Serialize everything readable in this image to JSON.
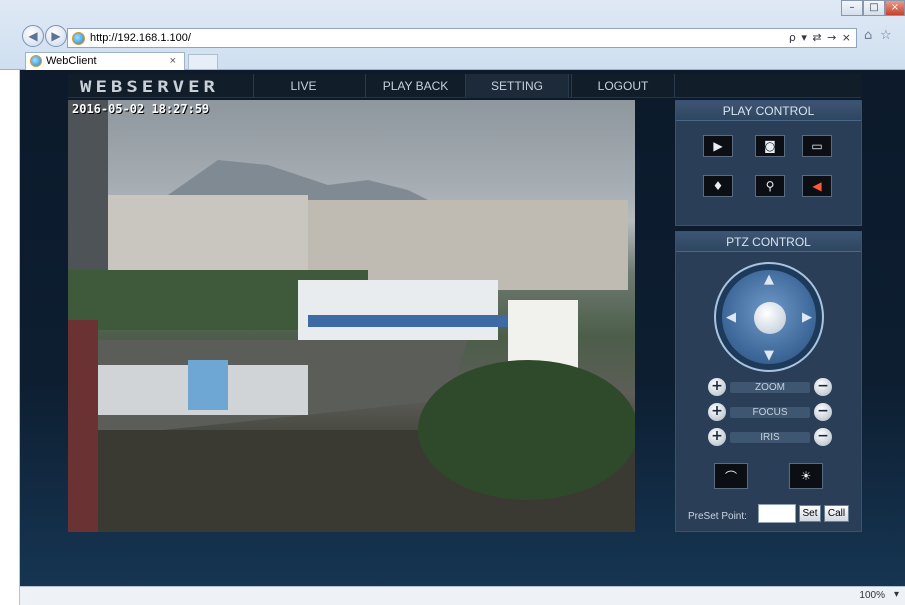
{
  "browser": {
    "url": "http://192.168.1.100/",
    "tab_title": "WebClient",
    "tab_close": "×",
    "address_tools": "ρ ▾ ⇄ → ×",
    "zoom": "100%",
    "zoom_caret": "▾"
  },
  "app": {
    "logo": "WEBSERVER",
    "nav": [
      "LIVE",
      "PLAY BACK",
      "SETTING",
      "LOGOUT"
    ],
    "active_nav": "SETTING"
  },
  "video": {
    "timestamp": "2016-05-02  18:27:59"
  },
  "play_control": {
    "title": "PLAY CONTROL",
    "buttons": [
      "play-icon",
      "snapshot-camera-icon",
      "record-icon",
      "microphone-icon",
      "zoom-magnifier-icon",
      "speaker-mute-icon"
    ]
  },
  "ptz_control": {
    "title": "PTZ CONTROL",
    "sliders": [
      "ZOOM",
      "FOCUS",
      "IRIS"
    ],
    "preset_label": "PreSet Point:",
    "preset_value": "",
    "set_label": "Set",
    "call_label": "Call"
  },
  "colors": {
    "page_bg": "#0c1a2b",
    "panel_bg": "#2a3e57",
    "joystick": "#3f6a9b"
  }
}
